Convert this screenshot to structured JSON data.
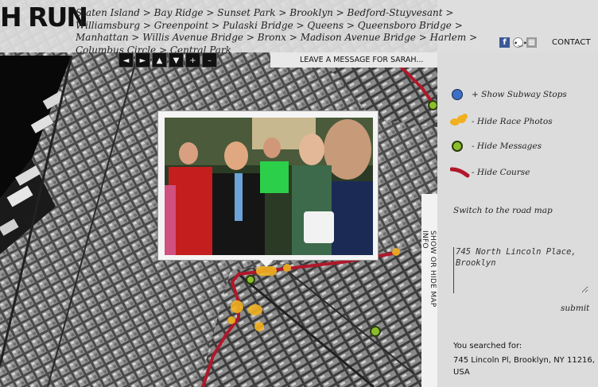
{
  "header": {
    "logo_text": "H RUN",
    "breadcrumb": [
      "Staten Island",
      "Bay Ridge",
      "Sunset Park",
      "Brooklyn",
      "Bedford-Stuyvesant",
      "Williamsburg",
      "Greenpoint",
      "Pulaski Bridge",
      "Queens",
      "Queensboro Bridge",
      "Manhattan",
      "Willis Avenue Bridge",
      "Bronx",
      "Madison Avenue Bridge",
      "Harlem",
      "Columbus Circle",
      "Central Park"
    ],
    "separator": ">",
    "contact_label": "CONTACT",
    "social_icons": [
      "facebook-icon",
      "reddit-icon",
      "delicious-icon"
    ]
  },
  "map_controls": {
    "buttons": [
      "◄",
      "►",
      "▲",
      "▼",
      "+",
      "–"
    ],
    "leave_message": "LEAVE A MESSAGE FOR SARAH..."
  },
  "side_tab": {
    "label": "SHOW OR HIDE MAP INFO"
  },
  "legend": {
    "show_subway": "+ Show Subway Stops",
    "hide_race_photos": "- Hide Race Photos",
    "hide_messages": "- Hide Messages",
    "hide_course": "- Hide Course"
  },
  "panel": {
    "road_map_link": "Switch to the road map",
    "address_value": "745 North Lincoln Place, Brooklyn",
    "submit_label": "submit",
    "searched_label": "You searched for:",
    "searched_value": "745 Lincoln Pl, Brooklyn, NY 11216, USA"
  },
  "colors": {
    "course": "#b0182a",
    "subway": "#3d6fc4",
    "photo_marker": "#f0b020",
    "message": "#8bbf2a"
  }
}
